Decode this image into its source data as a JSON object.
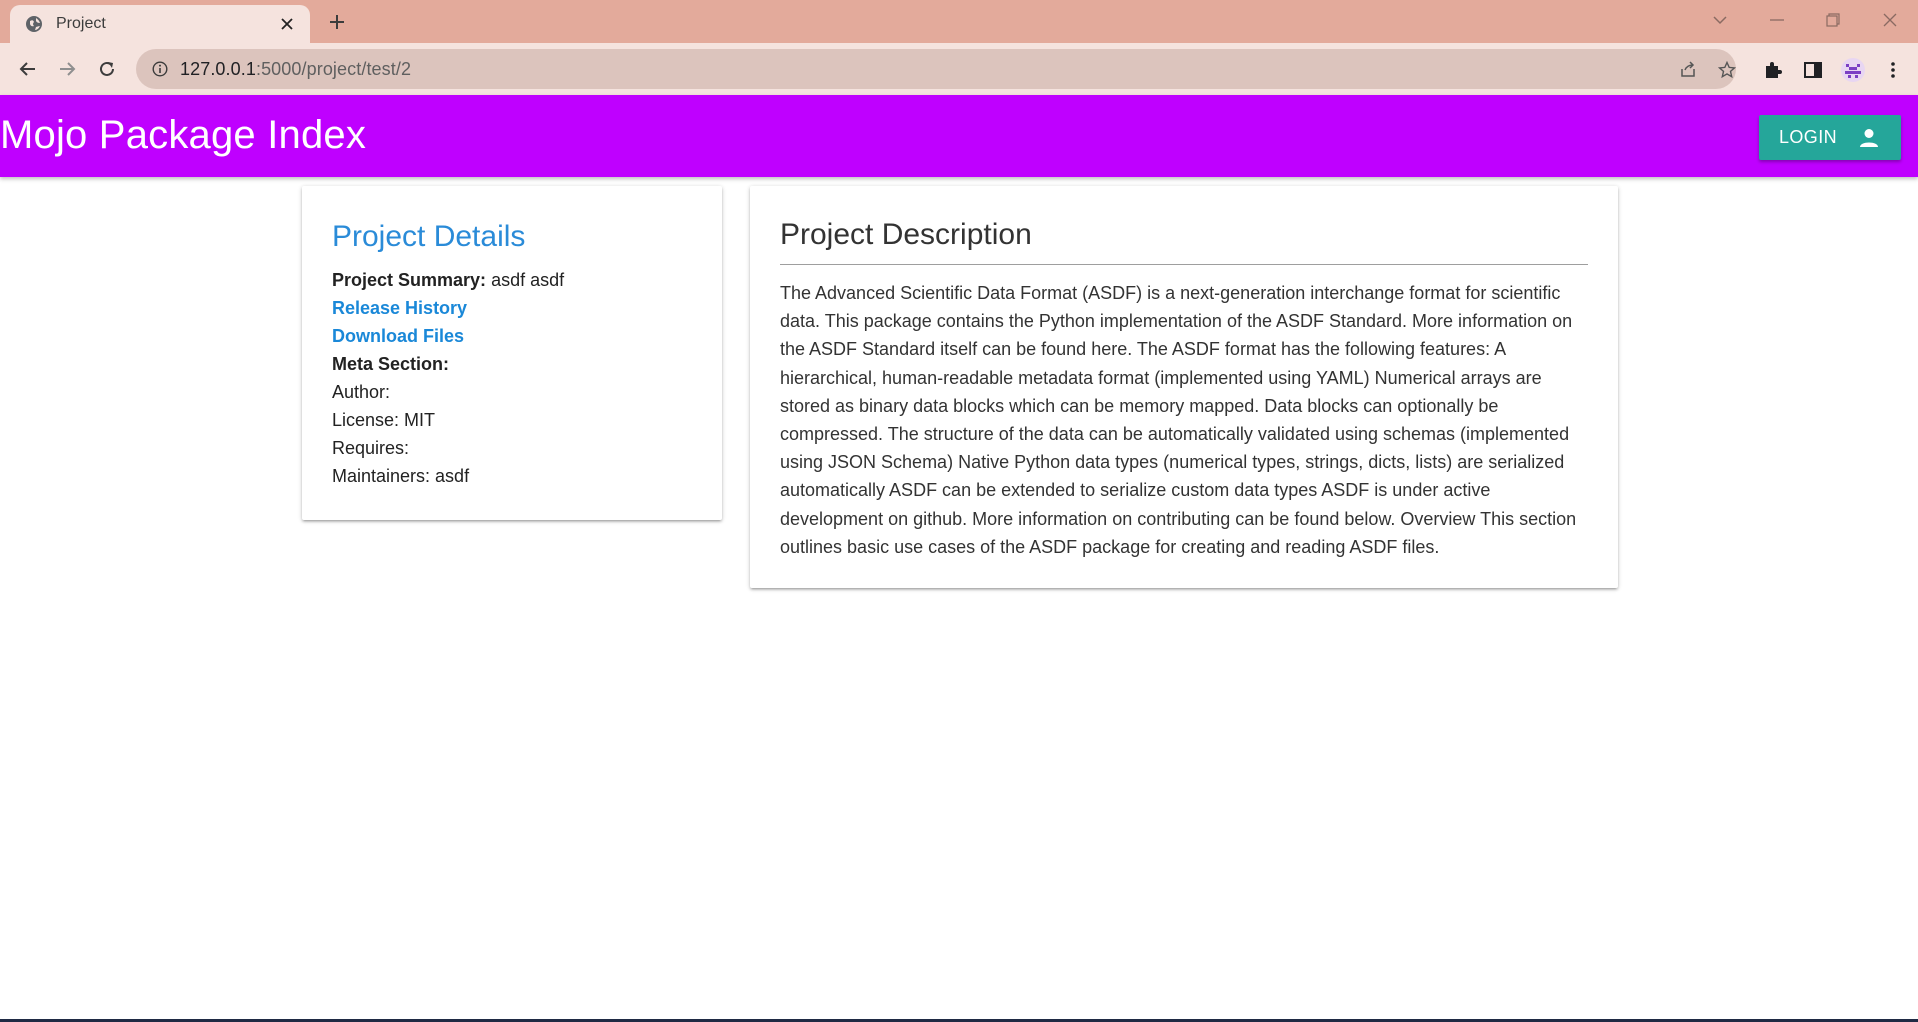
{
  "browser": {
    "tab_title": "Project",
    "url_host": "127.0.0.1",
    "url_rest": ":5000/project/test/2"
  },
  "app": {
    "brand": "Mojo Package Index",
    "login_label": "LOGIN",
    "colors": {
      "appbar": "#bf00ff",
      "login": "#25a69a",
      "link": "#1a88d8",
      "title_blue": "#2a8bd8"
    }
  },
  "details": {
    "title": "Project Details",
    "summary_label": "Project Summary:",
    "summary_value": "asdf asdf",
    "release_history": "Release History",
    "download_files": "Download Files",
    "meta_label": "Meta Section:",
    "author": "Author:",
    "license": "License: MIT",
    "requires": "Requires:",
    "maintainers": "Maintainers: asdf"
  },
  "description": {
    "title": "Project Description",
    "body": "The Advanced Scientific Data Format (ASDF) is a next-generation interchange format for scientific data. This package contains the Python implementation of the ASDF Standard. More information on the ASDF Standard itself can be found here. The ASDF format has the following features: A hierarchical, human-readable metadata format (implemented using YAML) Numerical arrays are stored as binary data blocks which can be memory mapped. Data blocks can optionally be compressed. The structure of the data can be automatically validated using schemas (implemented using JSON Schema) Native Python data types (numerical types, strings, dicts, lists) are serialized automatically ASDF can be extended to serialize custom data types ASDF is under active development on github. More information on contributing can be found below. Overview This section outlines basic use cases of the ASDF package for creating and reading ASDF files."
  }
}
